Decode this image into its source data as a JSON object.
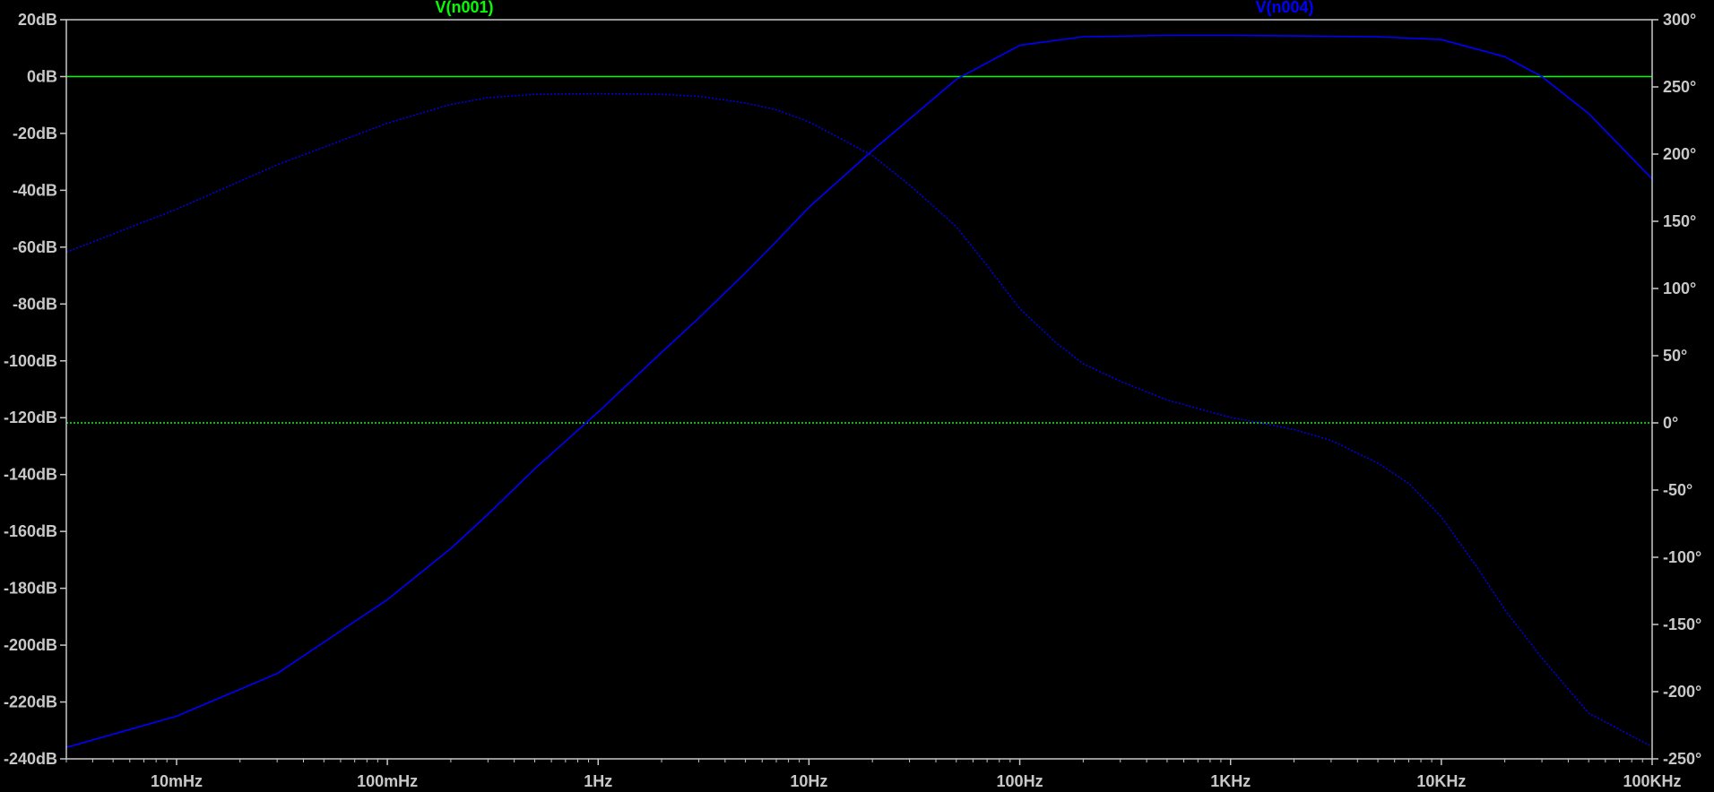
{
  "chart_data": {
    "type": "line",
    "xscale": "log",
    "xlim": [
      0.003,
      100000
    ],
    "x_ticks": [
      {
        "value": 0.01,
        "label": "10mHz"
      },
      {
        "value": 0.1,
        "label": "100mHz"
      },
      {
        "value": 1,
        "label": "1Hz"
      },
      {
        "value": 10,
        "label": "10Hz"
      },
      {
        "value": 100,
        "label": "100Hz"
      },
      {
        "value": 1000,
        "label": "1KHz"
      },
      {
        "value": 10000,
        "label": "10KHz"
      },
      {
        "value": 100000,
        "label": "100KHz"
      }
    ],
    "y_left": {
      "range": [
        -240,
        20
      ],
      "ticks": [
        {
          "value": 20,
          "label": "20dB"
        },
        {
          "value": 0,
          "label": "0dB"
        },
        {
          "value": -20,
          "label": "-20dB"
        },
        {
          "value": -40,
          "label": "-40dB"
        },
        {
          "value": -60,
          "label": "-60dB"
        },
        {
          "value": -80,
          "label": "-80dB"
        },
        {
          "value": -100,
          "label": "-100dB"
        },
        {
          "value": -120,
          "label": "-120dB"
        },
        {
          "value": -140,
          "label": "-140dB"
        },
        {
          "value": -160,
          "label": "-160dB"
        },
        {
          "value": -180,
          "label": "-180dB"
        },
        {
          "value": -200,
          "label": "-200dB"
        },
        {
          "value": -220,
          "label": "-220dB"
        },
        {
          "value": -240,
          "label": "-240dB"
        }
      ]
    },
    "y_right": {
      "range": [
        -250,
        300
      ],
      "ticks": [
        {
          "value": 300,
          "label": "300°"
        },
        {
          "value": 250,
          "label": "250°"
        },
        {
          "value": 200,
          "label": "200°"
        },
        {
          "value": 150,
          "label": "150°"
        },
        {
          "value": 100,
          "label": "100°"
        },
        {
          "value": 50,
          "label": "50°"
        },
        {
          "value": 0,
          "label": "0°"
        },
        {
          "value": -50,
          "label": "-50°"
        },
        {
          "value": -100,
          "label": "-100°"
        },
        {
          "value": -150,
          "label": "-150°"
        },
        {
          "value": -200,
          "label": "-200°"
        },
        {
          "value": -250,
          "label": "-250°"
        }
      ]
    },
    "series": [
      {
        "name": "V(n001)",
        "color": "#00ff00",
        "magnitude": {
          "x": [
            0.003,
            100000
          ],
          "y": [
            0,
            0
          ]
        },
        "phase": {
          "x": [
            0.003,
            100000
          ],
          "y": [
            0,
            0
          ]
        }
      },
      {
        "name": "V(n004)",
        "color": "#0000ff",
        "magnitude": {
          "x": [
            0.003,
            0.01,
            0.03,
            0.1,
            0.2,
            0.3,
            0.5,
            1,
            2,
            3,
            5,
            7,
            10,
            20,
            50,
            100,
            200,
            500,
            1000,
            2000,
            5000,
            10000,
            20000,
            30000,
            50000,
            100000
          ],
          "y": [
            -236,
            -225,
            -210,
            -184,
            -166,
            -154,
            -138,
            -118,
            -97,
            -85,
            -69,
            -58,
            -46,
            -26,
            -1,
            11,
            14,
            14.5,
            14.5,
            14.3,
            14,
            13,
            7,
            0,
            -13,
            -36
          ]
        },
        "phase": {
          "x": [
            0.003,
            0.01,
            0.03,
            0.1,
            0.2,
            0.3,
            0.5,
            1,
            2,
            3,
            5,
            7,
            10,
            20,
            30,
            50,
            70,
            100,
            150,
            200,
            300,
            500,
            1000,
            1500,
            2000,
            3000,
            5000,
            7000,
            10000,
            15000,
            20000,
            30000,
            50000,
            100000
          ],
          "y": [
            127,
            159,
            192,
            223,
            237,
            242,
            244.5,
            245,
            244.5,
            243,
            238,
            233,
            224,
            199,
            177,
            146,
            117,
            85,
            59,
            44,
            31,
            17,
            4,
            -1,
            -5,
            -13,
            -30,
            -45,
            -70,
            -109,
            -139,
            -175,
            -216,
            -241
          ]
        }
      }
    ],
    "grid": false,
    "legend": "top"
  }
}
